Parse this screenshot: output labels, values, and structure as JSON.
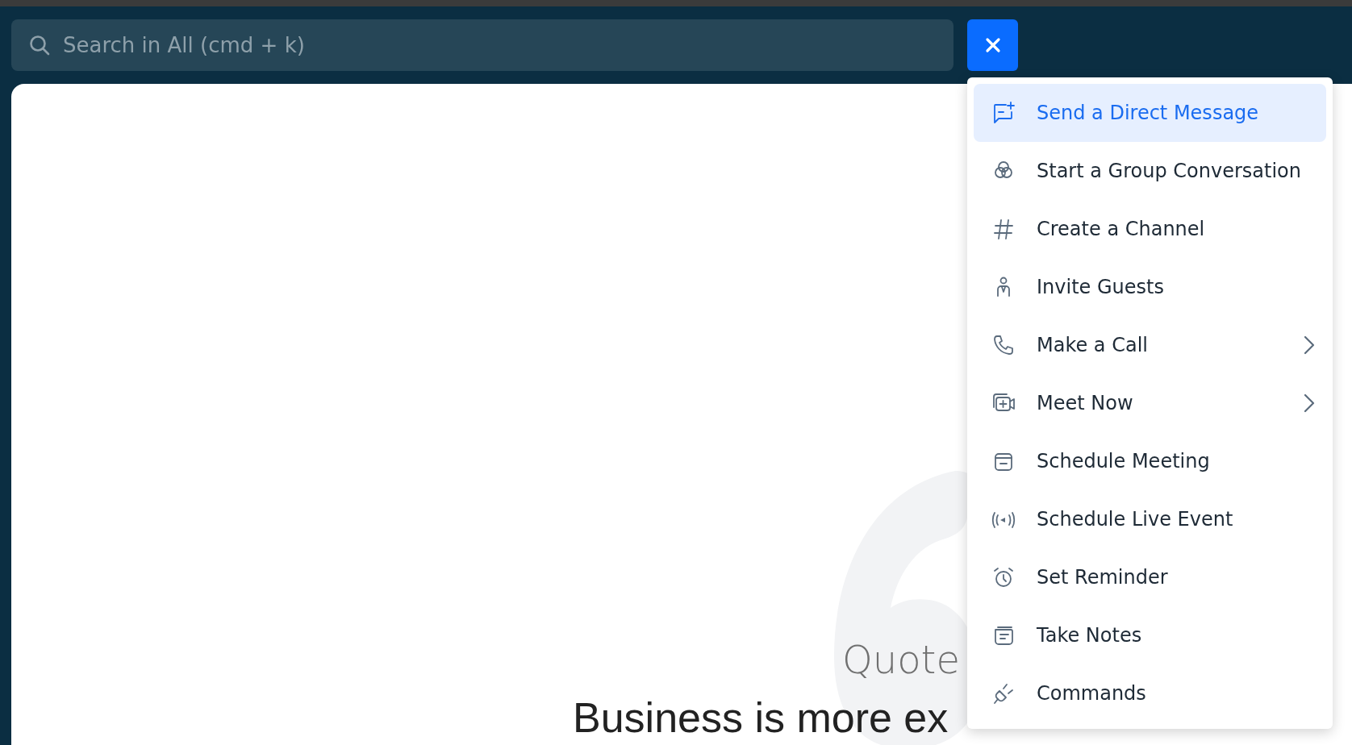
{
  "search": {
    "placeholder": "Search in All (cmd + k)"
  },
  "menu": {
    "items": [
      {
        "label": "Send a Direct Message",
        "selected": true,
        "submenu": false
      },
      {
        "label": "Start a Group Conversation",
        "selected": false,
        "submenu": false
      },
      {
        "label": "Create a Channel",
        "selected": false,
        "submenu": false
      },
      {
        "label": "Invite Guests",
        "selected": false,
        "submenu": false
      },
      {
        "label": "Make a Call",
        "selected": false,
        "submenu": true
      },
      {
        "label": "Meet Now",
        "selected": false,
        "submenu": true
      },
      {
        "label": "Schedule Meeting",
        "selected": false,
        "submenu": false
      },
      {
        "label": "Schedule Live Event",
        "selected": false,
        "submenu": false
      },
      {
        "label": "Set Reminder",
        "selected": false,
        "submenu": false
      },
      {
        "label": "Take Notes",
        "selected": false,
        "submenu": false
      },
      {
        "label": "Commands",
        "selected": false,
        "submenu": false
      }
    ]
  },
  "quote": {
    "label": "Quote",
    "text": "Business is more ex"
  }
}
